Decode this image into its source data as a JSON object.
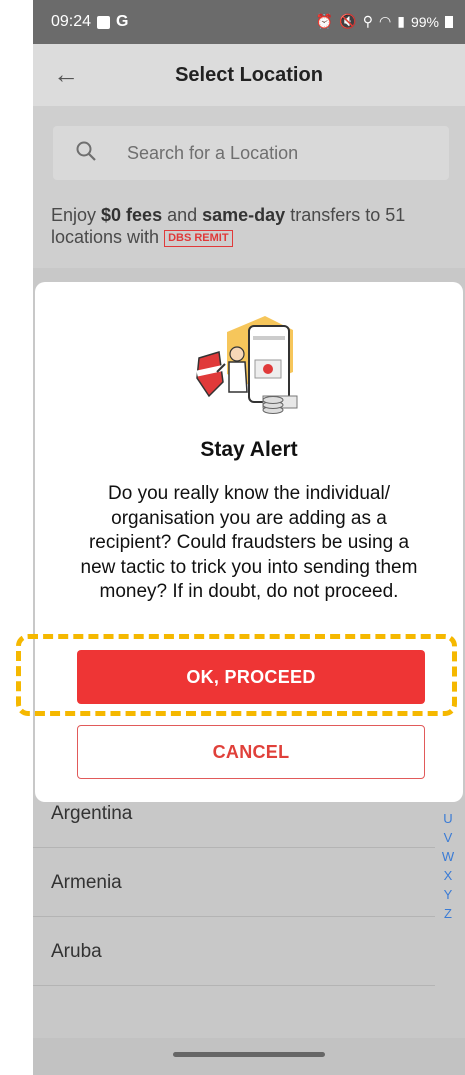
{
  "status_bar": {
    "time": "09:24",
    "battery": "99%"
  },
  "header": {
    "title": "Select Location",
    "back_icon": "arrow-left-icon"
  },
  "search": {
    "placeholder": "Search for a Location"
  },
  "promo": {
    "t1": "Enjoy ",
    "t2": "$0 fees",
    "t3": " and ",
    "t4": "same-day",
    "t5": " transfers to 51 locations with ",
    "badge": "DBS REMIT"
  },
  "dialog": {
    "title": "Stay Alert",
    "body": "Do you really know the individual/ organisation you are adding as a recipient? Could fraudsters be using a new tactic to trick you into sending them money? If in doubt, do not proceed.",
    "ok_label": "OK, PROCEED",
    "cancel_label": "CANCEL"
  },
  "locations": [
    "Argentina",
    "Armenia",
    "Aruba"
  ],
  "alphabet_index": [
    "U",
    "V",
    "W",
    "X",
    "Y",
    "Z"
  ],
  "colors": {
    "accent": "#ee3535",
    "highlight": "#f5b800",
    "index": "#3a7bd5"
  }
}
